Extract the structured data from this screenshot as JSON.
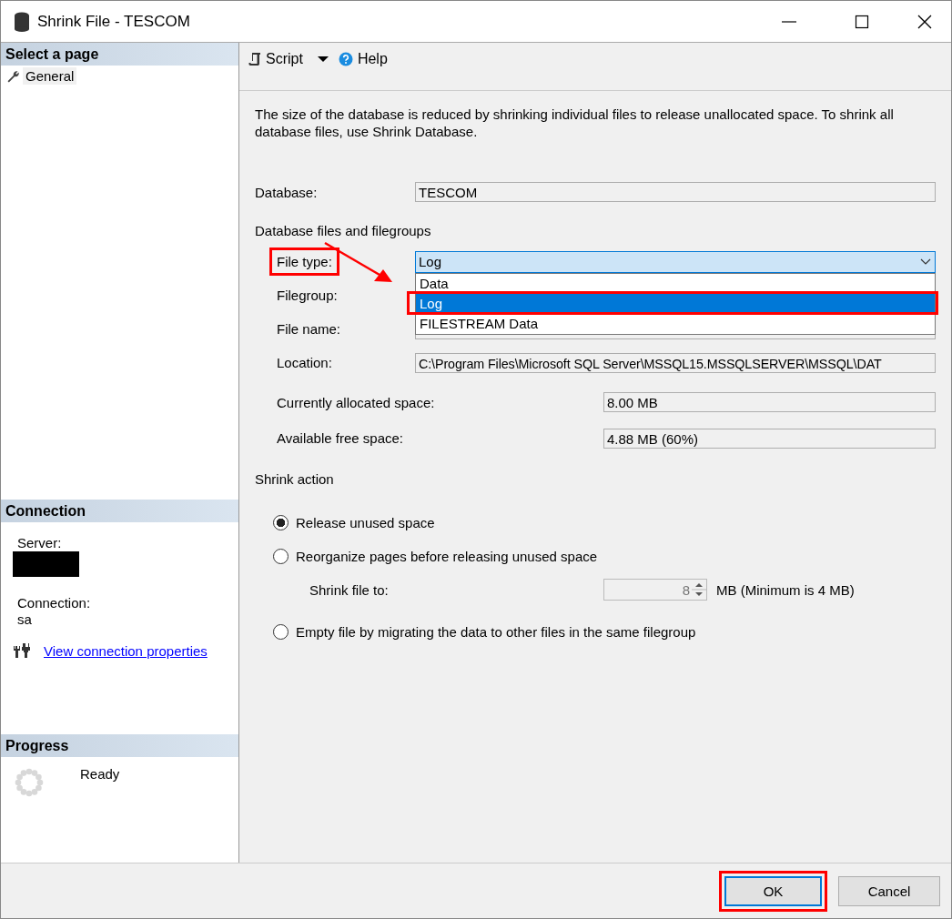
{
  "window": {
    "title": "Shrink File - TESCOM"
  },
  "sidebar": {
    "select_page": {
      "heading": "Select a page",
      "items": [
        {
          "label": "General",
          "selected": true
        }
      ]
    },
    "connection": {
      "heading": "Connection",
      "server_label": "Server:",
      "server_redacted": true,
      "connection_label": "Connection:",
      "connection_value": "sa",
      "link": "View connection properties"
    },
    "progress": {
      "heading": "Progress",
      "status": "Ready"
    }
  },
  "toolbar": {
    "items": [
      {
        "kind": "script",
        "label": "Script"
      },
      {
        "kind": "help",
        "label": "Help"
      }
    ]
  },
  "description": "The size of the database is reduced by shrinking individual files to release unallocated space. To shrink all database files, use Shrink Database.",
  "database": {
    "label": "Database:",
    "value": "TESCOM"
  },
  "files_section": {
    "heading": "Database files and filegroups",
    "file_type": {
      "label": "File type:",
      "value": "Log",
      "highlighted": true,
      "expanded": true,
      "options": [
        {
          "label": "Data",
          "selected": false,
          "highlighted": false
        },
        {
          "label": "Log",
          "selected": true,
          "highlighted": true
        },
        {
          "label": "FILESTREAM Data",
          "selected": false,
          "highlighted": false
        }
      ]
    },
    "filegroup": {
      "label": "Filegroup:"
    },
    "file_name": {
      "label": "File name:"
    },
    "location": {
      "label": "Location:",
      "value": "C:\\Program Files\\Microsoft SQL Server\\MSSQL15.MSSQLSERVER\\MSSQL\\DAT"
    },
    "allocated": {
      "label": "Currently allocated space:",
      "value": "8.00 MB"
    },
    "free": {
      "label": "Available free space:",
      "value": "4.88 MB (60%)"
    }
  },
  "shrink_action": {
    "heading": "Shrink action",
    "options": [
      {
        "label": "Release unused space",
        "selected": true
      },
      {
        "label": "Reorganize pages before releasing unused space",
        "selected": false,
        "shrink_to": {
          "label": "Shrink file to:",
          "value": "8",
          "unit": "MB (Minimum is 4 MB)",
          "disabled": true
        }
      },
      {
        "label": "Empty file by migrating the data to other files in the same filegroup",
        "selected": false
      }
    ]
  },
  "buttons": [
    {
      "label": "OK",
      "default": true,
      "highlighted": true
    },
    {
      "label": "Cancel",
      "default": false,
      "highlighted": false
    }
  ],
  "annotation_arrow": true
}
